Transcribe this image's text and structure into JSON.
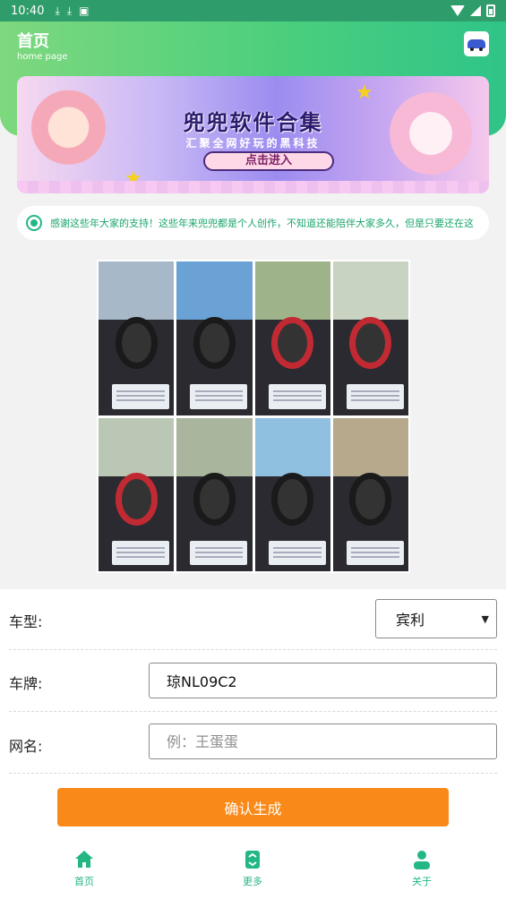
{
  "status_bar": {
    "time": "10:40",
    "icons": [
      "download-icon",
      "download-icon",
      "a-icon"
    ],
    "right_icons": [
      "wifi-icon",
      "signal-icon",
      "battery-icon"
    ]
  },
  "header": {
    "title": "首页",
    "subtitle": "home page",
    "avatar_icon": "car-icon",
    "gradient": [
      "#7ed87e",
      "#2fc489"
    ]
  },
  "banner": {
    "title": "兜兜软件合集",
    "subtitle": "汇聚全网好玩的黑科技",
    "button": "点击进入"
  },
  "notice": {
    "icon": "radio-dot-icon",
    "text": "感谢这些年大家的支持！这些年来兜兜都是个人创作，不知道还能陪伴大家多久，但是只要还在这"
  },
  "collage": {
    "photos": [
      {
        "sky": "#a7b9c8",
        "wheel": "black"
      },
      {
        "sky": "#6aa2d6",
        "wheel": "black"
      },
      {
        "sky": "#9fb38a",
        "wheel": "red"
      },
      {
        "sky": "#c8d3c2",
        "wheel": "red"
      },
      {
        "sky": "#b9c7b4",
        "wheel": "red"
      },
      {
        "sky": "#a9b59c",
        "wheel": "black"
      },
      {
        "sky": "#8fc0e0",
        "wheel": "black"
      },
      {
        "sky": "#b7a98c",
        "wheel": "black"
      }
    ]
  },
  "form": {
    "model_label": "车型:",
    "model_value": "宾利",
    "plate_label": "车牌:",
    "plate_value": "琼NL09C2",
    "name_label": "网名:",
    "name_placeholder": "例：王蛋蛋",
    "confirm_label": "确认生成"
  },
  "nav": {
    "items": [
      {
        "label": "首页",
        "icon": "home-icon"
      },
      {
        "label": "更多",
        "icon": "more-icon"
      },
      {
        "label": "关于",
        "icon": "user-icon"
      }
    ],
    "active_color": "#23b784"
  },
  "colors": {
    "accent": "#23b784",
    "button": "#f98a1a"
  }
}
